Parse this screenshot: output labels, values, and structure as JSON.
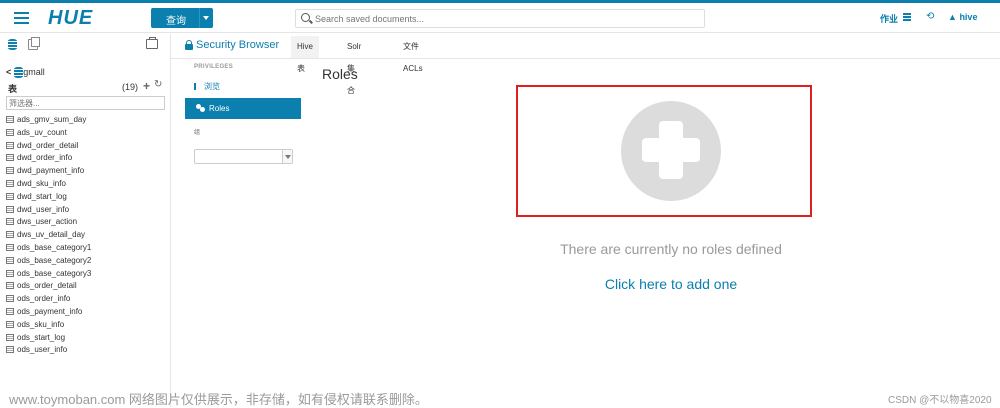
{
  "app": {
    "logo": "HUE",
    "accent": "#0b7fad"
  },
  "topbar": {
    "query_label": "查询",
    "search_placeholder": "Search saved documents...",
    "jobs_label": "作业",
    "history_icon": "history-icon",
    "user_label": "hive"
  },
  "left_panel": {
    "database": "gmall",
    "tables_header": "表",
    "table_count": "(19)",
    "filter_placeholder": "筛选器...",
    "tables": [
      "ads_gmv_sum_day",
      "ads_uv_count",
      "dwd_order_detail",
      "dwd_order_info",
      "dwd_payment_info",
      "dwd_sku_info",
      "dwd_start_log",
      "dwd_user_info",
      "dws_user_action",
      "dws_uv_detail_day",
      "ods_base_category1",
      "ods_base_category2",
      "ods_base_category3",
      "ods_order_detail",
      "ods_order_info",
      "ods_payment_info",
      "ods_sku_info",
      "ods_start_log",
      "ods_user_info"
    ]
  },
  "security": {
    "title": "Security Browser",
    "tabs": [
      {
        "label": "Hive 表",
        "active": true
      },
      {
        "label": "Solr 集合",
        "active": false
      },
      {
        "label": "文件 ACLs",
        "active": false
      }
    ],
    "privileges_label": "PRIVILEGES",
    "nav_browse": "浏览",
    "nav_roles": "Roles",
    "nav_group": "组",
    "roles_heading": "Roles",
    "empty_message": "There are currently no roles defined",
    "add_link": "Click here to add one",
    "highlight_color": "#e02020"
  },
  "overlay": {
    "watermark": "www.toymoban.com 网络图片仅供展示，非存储，如有侵权请联系删除。",
    "credit": "CSDN @不以物喜2020"
  }
}
